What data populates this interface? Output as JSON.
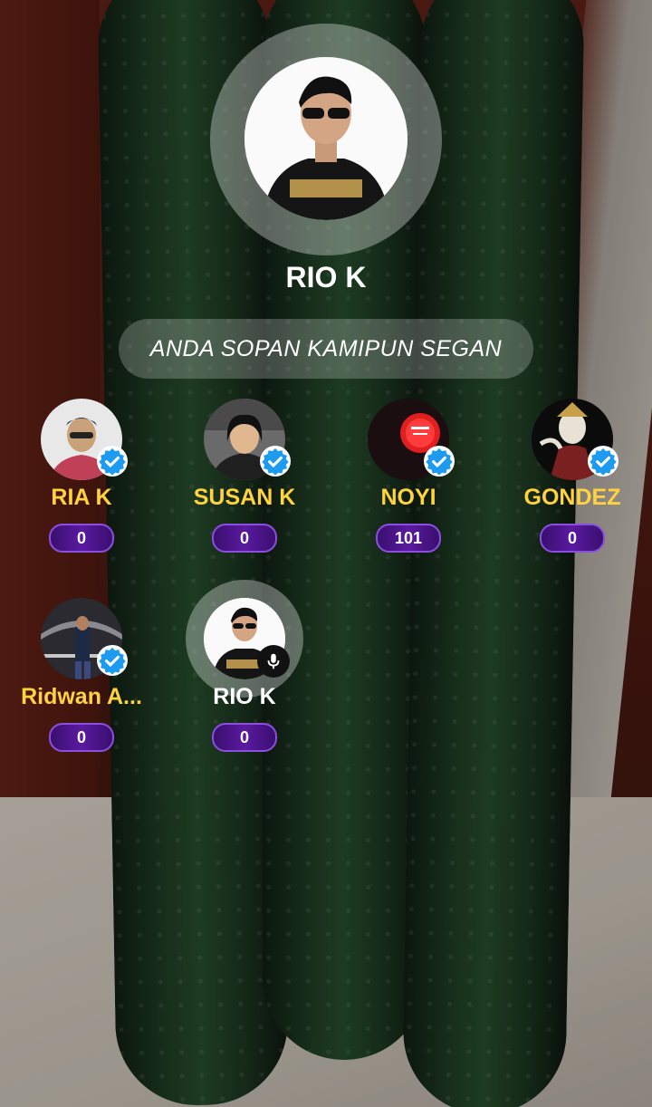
{
  "room": {
    "host": {
      "name": "RIO K",
      "avatar_icon": "host-avatar"
    },
    "topic": "ANDA SOPAN KAMIPUN SEGAN"
  },
  "seats": [
    {
      "name": "RIA K",
      "count": "0",
      "verified": true
    },
    {
      "name": "SUSAN K",
      "count": "0",
      "verified": true
    },
    {
      "name": "NOYI",
      "count": "101",
      "verified": true
    },
    {
      "name": "GONDEZ",
      "count": "0",
      "verified": true
    },
    {
      "name": "Ridwan A...",
      "count": "0",
      "verified": true
    },
    {
      "name": "RIO K",
      "count": "0",
      "verified": false,
      "speaking": true
    }
  ],
  "colors": {
    "name_gold": "#ffd23f",
    "verified_blue": "#1d9bf0",
    "count_purple": "#5a1aa0"
  },
  "icons": {
    "verified": "verified-badge-icon",
    "mic": "microphone-icon"
  }
}
